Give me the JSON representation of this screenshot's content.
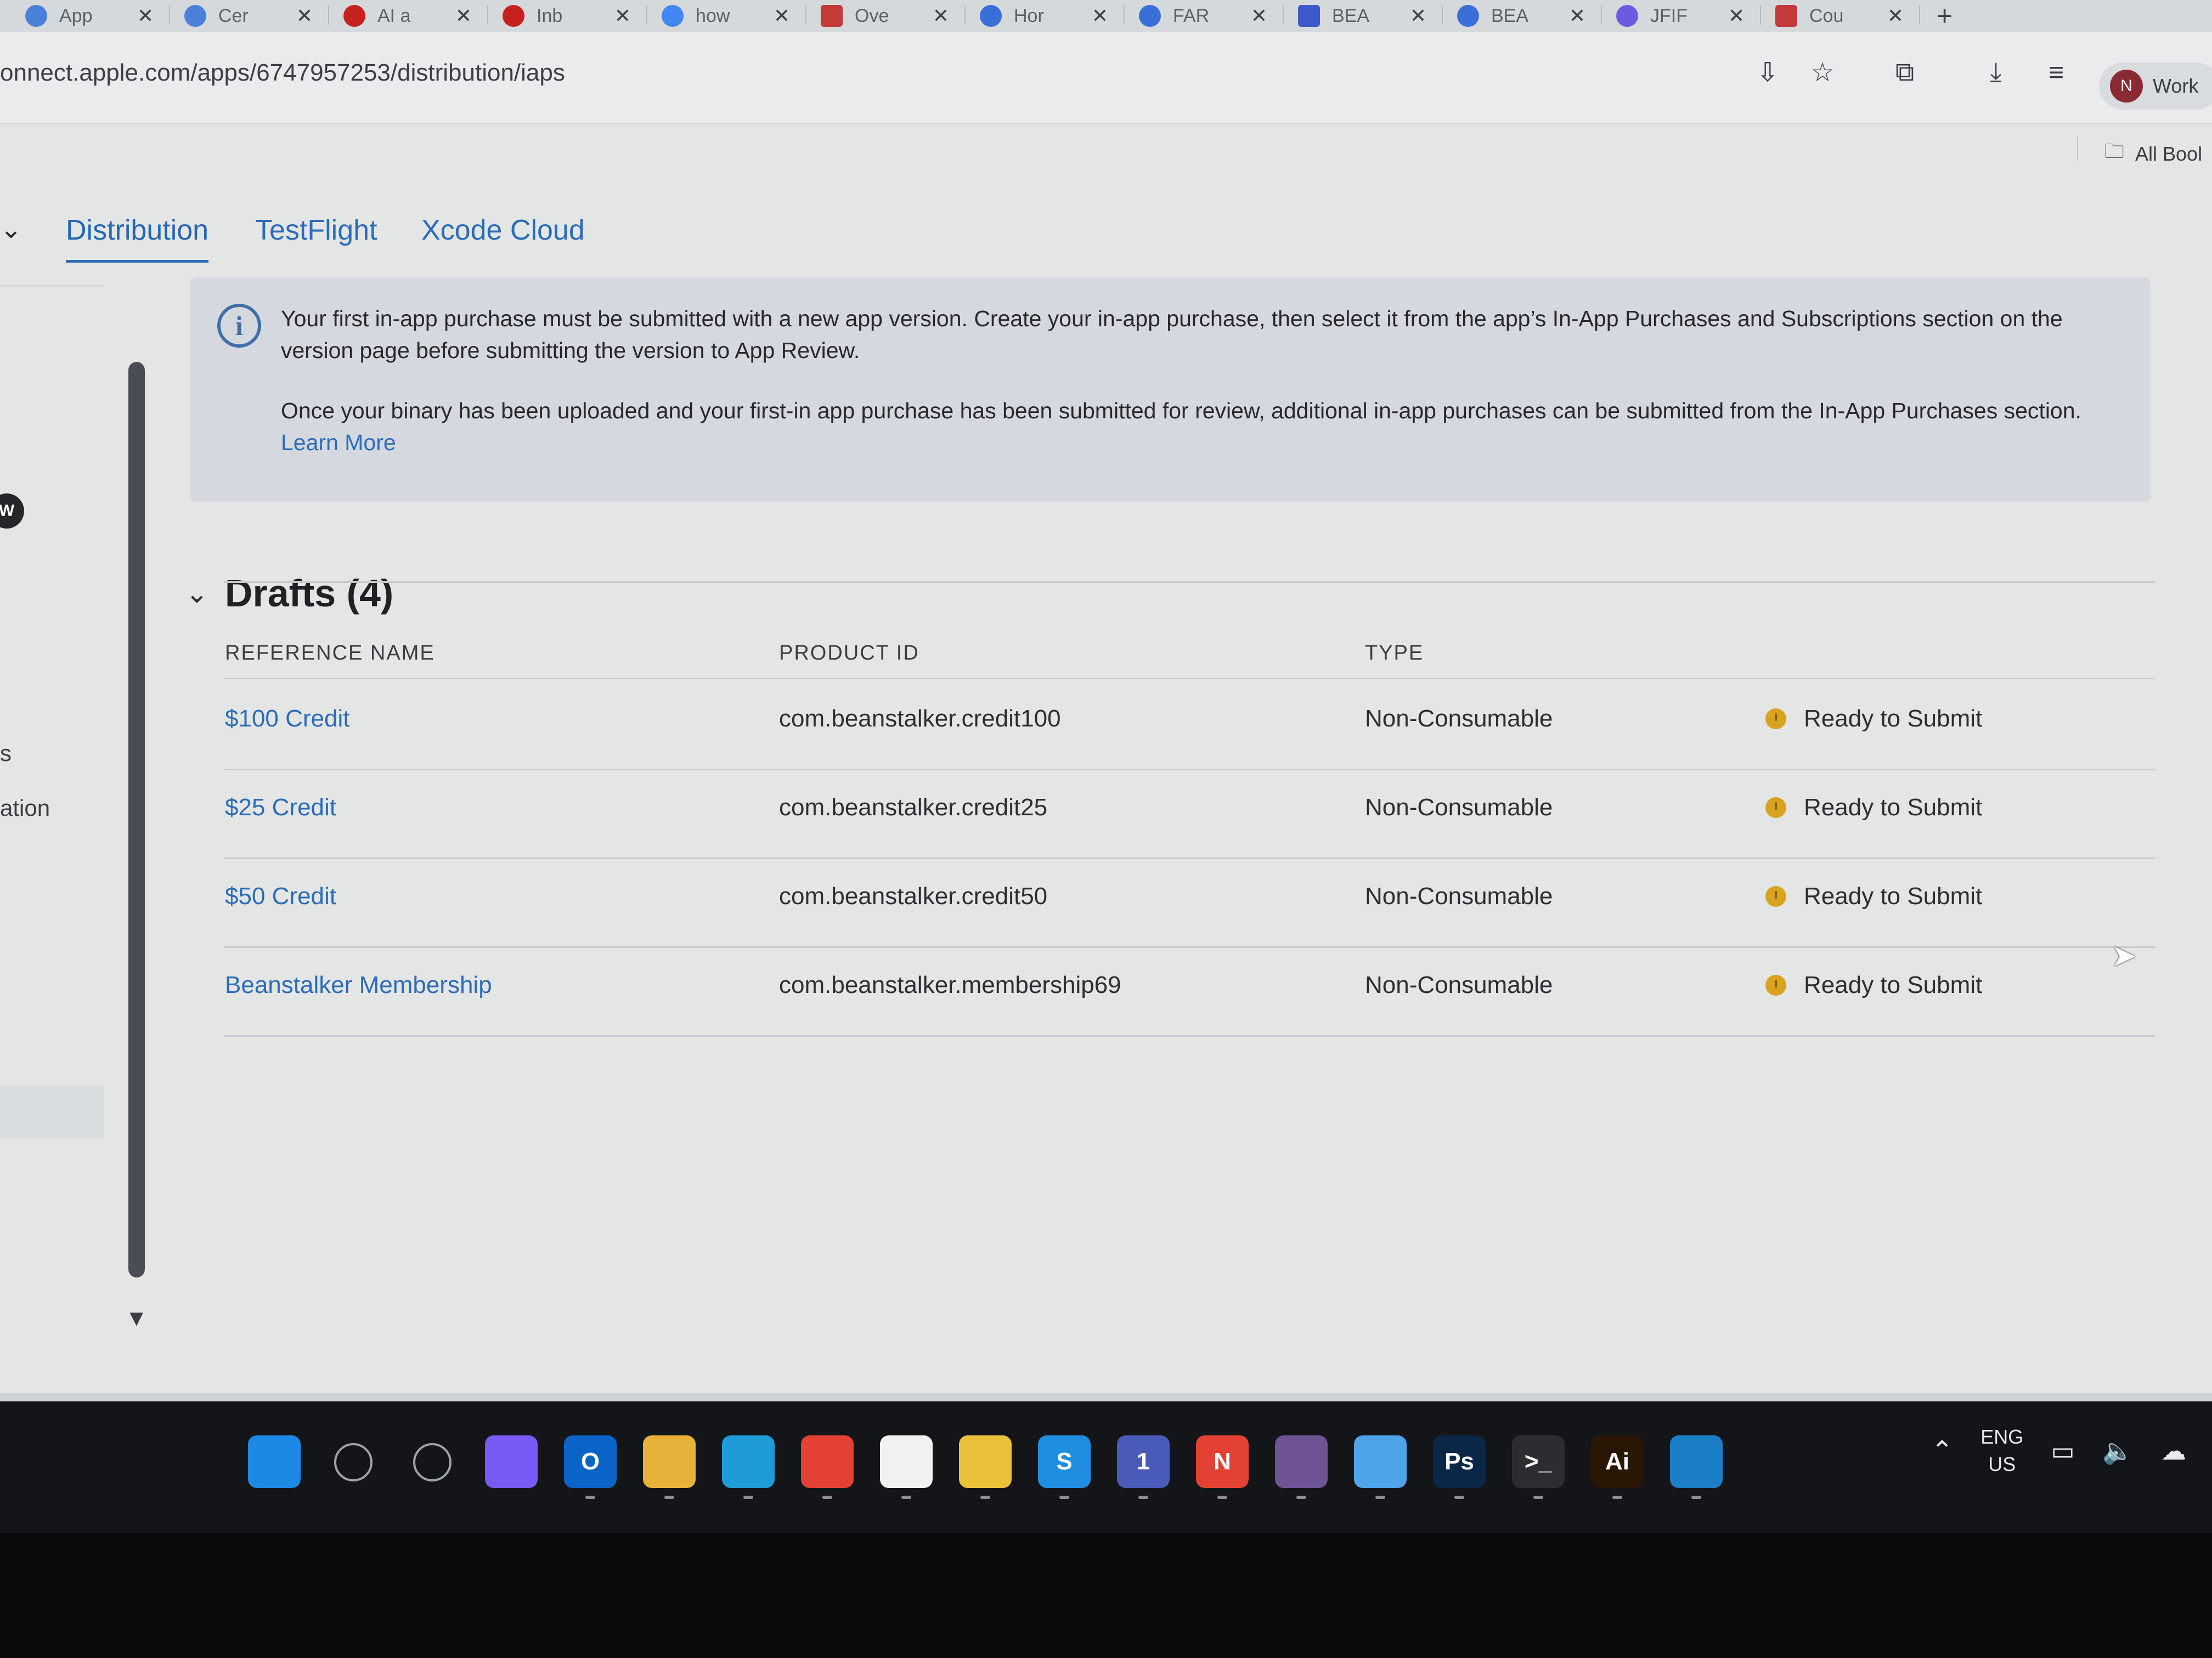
{
  "browser": {
    "tabs": [
      {
        "title": "App",
        "favicon": "chrome-icon",
        "color": "#4a80d8"
      },
      {
        "title": "Cer",
        "favicon": "chrome-icon",
        "color": "#4a80d8"
      },
      {
        "title": "AI a",
        "favicon": "gmail-icon",
        "color": "#c5221f"
      },
      {
        "title": "Inb",
        "favicon": "gmail-icon",
        "color": "#c5221f"
      },
      {
        "title": "how",
        "favicon": "google-icon",
        "color": "#4285f4"
      },
      {
        "title": "Ove",
        "favicon": "bs-icon",
        "color": "#c33b3b"
      },
      {
        "title": "Hor",
        "favicon": "c-icon",
        "color": "#3a6fd8"
      },
      {
        "title": "FAR",
        "favicon": "c-icon",
        "color": "#3a6fd8"
      },
      {
        "title": "BEA",
        "favicon": "doc-icon",
        "color": "#3a5bc8"
      },
      {
        "title": "BEA",
        "favicon": "c-icon",
        "color": "#3a6fd8"
      },
      {
        "title": "JFIF",
        "favicon": "circle-icon",
        "color": "#6a5be0"
      },
      {
        "title": "Cou",
        "favicon": "bs-icon",
        "color": "#c33b3b"
      }
    ],
    "new_tab_label": "+",
    "url": "onnect.apple.com/apps/6747957253/distribution/iaps",
    "profile_initial": "N",
    "profile_label": "Work",
    "bookmarks_label": "All Bool"
  },
  "nav": {
    "tabs": [
      "Distribution",
      "TestFlight",
      "Xcode Cloud"
    ],
    "active_tab": "Distribution"
  },
  "sidebar": {
    "badge": "W",
    "items": [
      "s",
      "ation"
    ]
  },
  "banner": {
    "paragraph1": "Your first in-app purchase must be submitted with a new app version. Create your in-app purchase, then select it from the app’s In-App Purchases and Subscriptions section on the version page before submitting the version to App Review.",
    "paragraph2": "Once your binary has been uploaded and your first-in app purchase has been submitted for review, additional in-app purchases can be submitted from the In-App Purchases section.",
    "link_label": "Learn More"
  },
  "drafts": {
    "title": "Drafts (4)",
    "columns": [
      "REFERENCE NAME",
      "PRODUCT ID",
      "TYPE"
    ],
    "rows": [
      {
        "name": "$100 Credit",
        "product_id": "com.beanstalker.credit100",
        "type": "Non-Consumable",
        "status": "Ready to Submit"
      },
      {
        "name": "$25 Credit",
        "product_id": "com.beanstalker.credit25",
        "type": "Non-Consumable",
        "status": "Ready to Submit"
      },
      {
        "name": "$50 Credit",
        "product_id": "com.beanstalker.credit50",
        "type": "Non-Consumable",
        "status": "Ready to Submit"
      },
      {
        "name": "Beanstalker Membership",
        "product_id": "com.beanstalker.membership69",
        "type": "Non-Consumable",
        "status": "Ready to Submit"
      }
    ],
    "status_color": "#d9a21f"
  },
  "taskbar": {
    "apps": [
      {
        "name": "start-icon",
        "glyph": "",
        "color": "#1e88e5"
      },
      {
        "name": "search-icon",
        "glyph": "",
        "color": "#141518"
      },
      {
        "name": "task-view-icon",
        "glyph": "",
        "color": "#141518"
      },
      {
        "name": "copilot-icon",
        "glyph": "",
        "color": "#7a5af5"
      },
      {
        "name": "outlook-icon",
        "glyph": "O",
        "color": "#0a64c8"
      },
      {
        "name": "file-explorer-icon",
        "glyph": "",
        "color": "#e8b23a"
      },
      {
        "name": "edge-icon",
        "glyph": "",
        "color": "#1f9bd8"
      },
      {
        "name": "chrome-icon",
        "glyph": "",
        "color": "#e34133"
      },
      {
        "name": "notepad-file-icon",
        "glyph": "",
        "color": "#f1f1f1"
      },
      {
        "name": "sticky-notes-icon",
        "glyph": "",
        "color": "#e9c23a"
      },
      {
        "name": "skype-icon",
        "glyph": "S",
        "color": "#1f8ee0"
      },
      {
        "name": "teams-icon",
        "glyph": "1",
        "color": "#4a5ab8"
      },
      {
        "name": "chrome-profile-icon",
        "glyph": "N",
        "color": "#e34133"
      },
      {
        "name": "github-icon",
        "glyph": "",
        "color": "#6e5494"
      },
      {
        "name": "notepad-icon",
        "glyph": "",
        "color": "#4fa3e8"
      },
      {
        "name": "photoshop-icon",
        "glyph": "Ps",
        "color": "#0a2748"
      },
      {
        "name": "terminal-icon",
        "glyph": ">_",
        "color": "#2b2d31"
      },
      {
        "name": "illustrator-icon",
        "glyph": "Ai",
        "color": "#2a1604"
      },
      {
        "name": "edge-dev-icon",
        "glyph": "",
        "color": "#1b7fc8"
      }
    ],
    "language_line1": "ENG",
    "language_line2": "US"
  }
}
